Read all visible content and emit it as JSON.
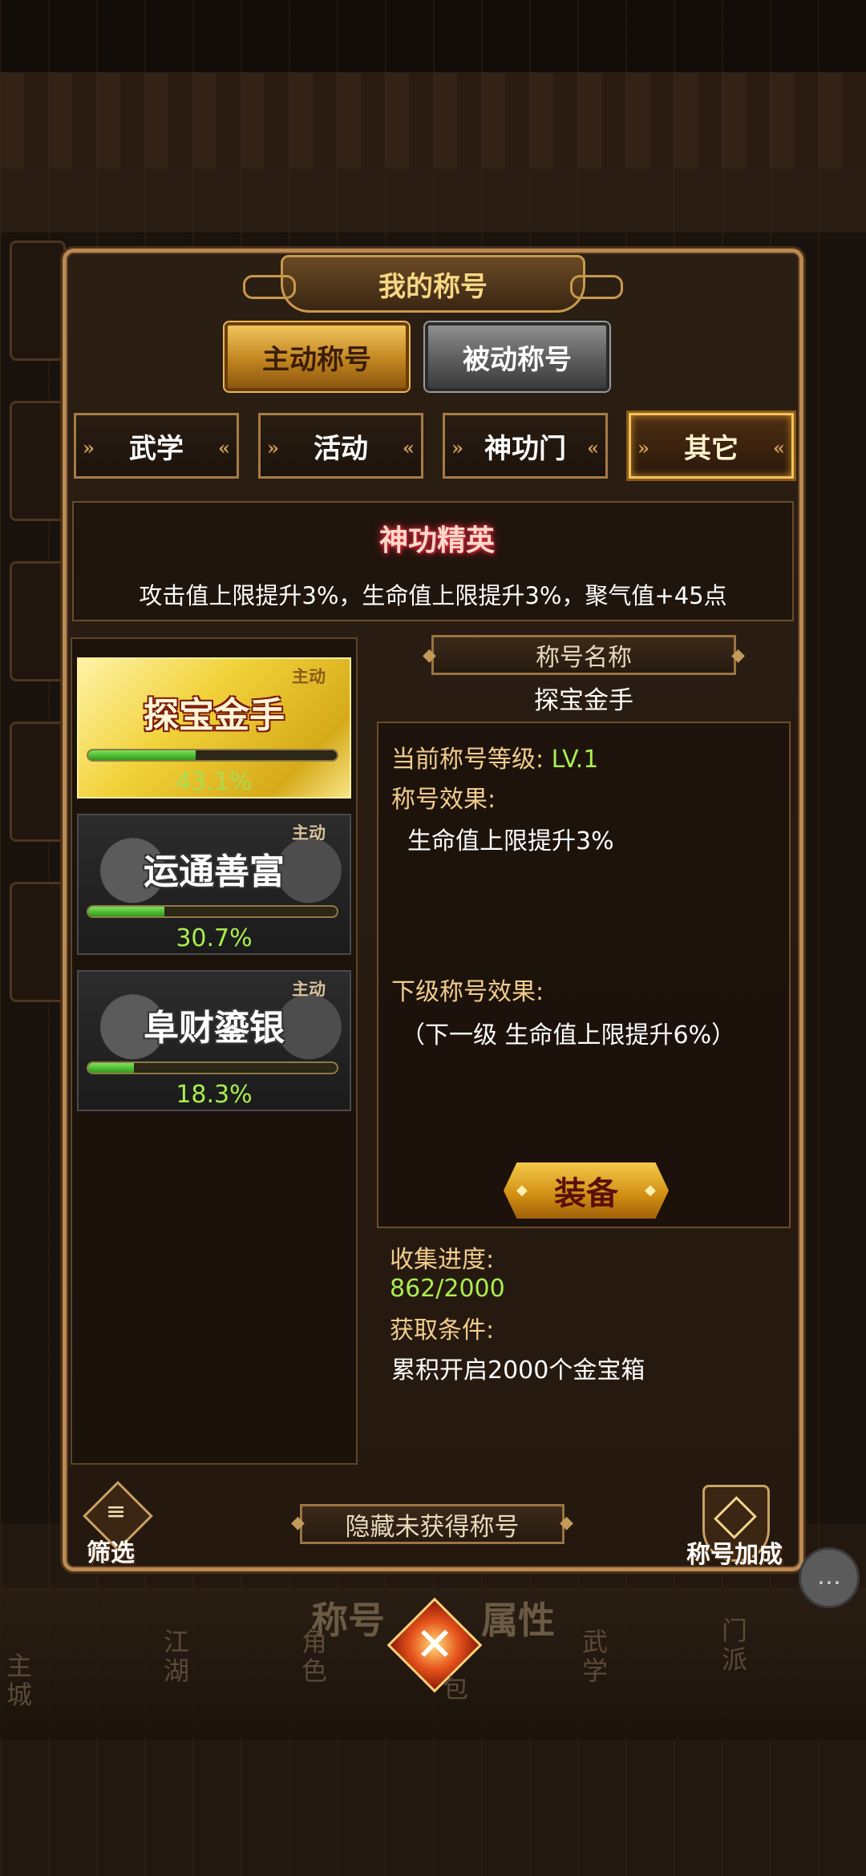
{
  "dialog": {
    "title": "我的称号"
  },
  "main_tabs": [
    {
      "label": "主动称号",
      "active": true
    },
    {
      "label": "被动称号",
      "active": false
    }
  ],
  "sub_tabs": [
    {
      "label": "武学",
      "active": false
    },
    {
      "label": "活动",
      "active": false
    },
    {
      "label": "神功门",
      "active": false
    },
    {
      "label": "其它",
      "active": true
    }
  ],
  "set_bonus": {
    "title": "神功精英",
    "description": "攻击值上限提升3%，生命值上限提升3%，聚气值+45点"
  },
  "titles": [
    {
      "name": "探宝金手",
      "tag": "主动",
      "progress_pct": 43.1,
      "progress_text": "43.1%",
      "selected": true
    },
    {
      "name": "运通善富",
      "tag": "主动",
      "progress_pct": 30.7,
      "progress_text": "30.7%",
      "selected": false
    },
    {
      "name": "阜财鎏银",
      "tag": "主动",
      "progress_pct": 18.3,
      "progress_text": "18.3%",
      "selected": false
    }
  ],
  "detail": {
    "header": "称号名称",
    "name": "探宝金手",
    "level_label": "当前称号等级: ",
    "level_value": "LV.1",
    "effect_label": "称号效果:",
    "effect_value": "生命值上限提升3%",
    "next_label": "下级称号效果:",
    "next_value": "（下一级 生命值上限提升6%）",
    "equip_label": "装备",
    "collect_label": "收集进度:",
    "collect_value": "862/2000",
    "condition_label": "获取条件:",
    "condition_value": "累积开启2000个金宝箱"
  },
  "bottom": {
    "filter_label": "筛选",
    "hide_label": "隐藏未获得称号",
    "bonus_label": "称号加成"
  },
  "nav": {
    "tab_left": "称号",
    "tab_right": "属性",
    "items": [
      "主城",
      "江湖",
      "角色",
      "包",
      "武学",
      "门派"
    ]
  },
  "colors": {
    "accent_gold": "#f2cd8c",
    "progress_green": "#a9ee4e",
    "panel_border": "#b98a52"
  }
}
